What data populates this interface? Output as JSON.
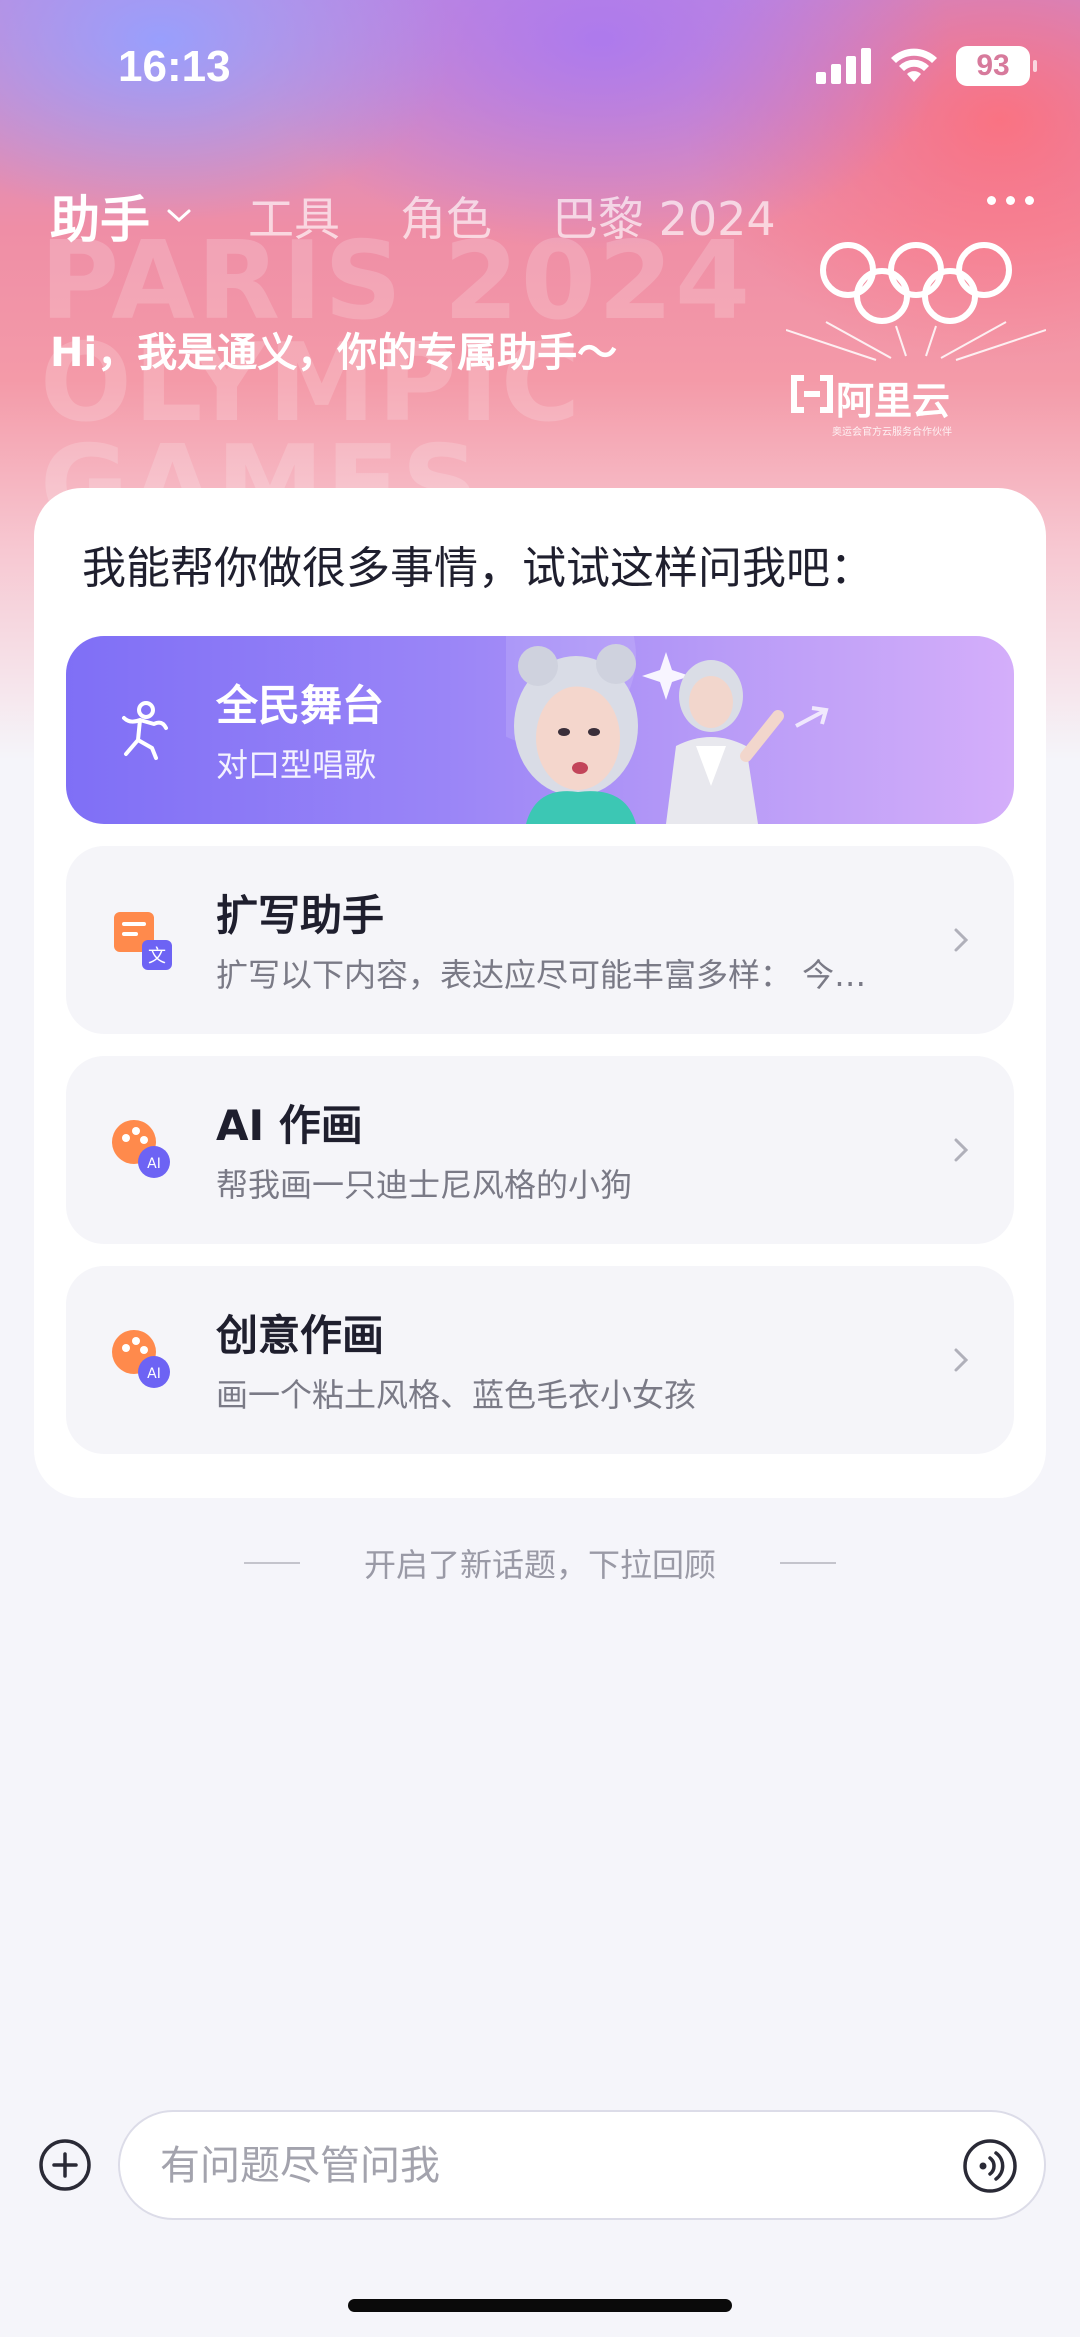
{
  "status": {
    "time": "16:13",
    "battery": "93"
  },
  "tabs": [
    {
      "label": "助手"
    },
    {
      "label": "工具"
    },
    {
      "label": "角色"
    },
    {
      "label": "巴黎 2024"
    }
  ],
  "background_text": [
    "PARIS 2024",
    "OLYMPIC",
    "GAMES"
  ],
  "greeting": "Hi，我是通义，你的专属助手～",
  "sponsor": {
    "brand": "阿里云",
    "sub": "奥运会官方云服务合作伙伴"
  },
  "card": {
    "title": "我能帮你做很多事情，试试这样问我吧：",
    "featured": {
      "title": "全民舞台",
      "subtitle": "对口型唱歌"
    },
    "items": [
      {
        "title": "扩写助手",
        "subtitle": "扩写以下内容，表达应尽可能丰富多样： 今…",
        "icon": "document-translate-icon"
      },
      {
        "title": "AI 作画",
        "subtitle": "帮我画一只迪士尼风格的小狗",
        "icon": "palette-ai-icon"
      },
      {
        "title": "创意作画",
        "subtitle": "画一个粘土风格、蓝色毛衣小女孩",
        "icon": "palette-ai-icon"
      }
    ]
  },
  "divider_text": "开启了新话题，下拉回顾",
  "input": {
    "placeholder": "有问题尽管问我"
  },
  "colors": {
    "accent": "#7f6ff6",
    "icon_orange": "#ff8a4c",
    "icon_purple": "#6d63f4"
  }
}
